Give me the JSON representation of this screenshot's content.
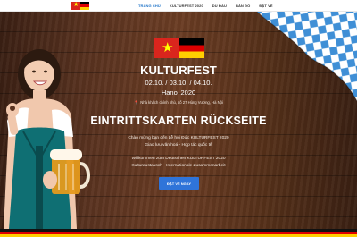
{
  "header": {
    "logo_alt": "Vietnam and Germany flags logo",
    "nav": [
      {
        "label": "TRANG CHỦ",
        "active": true
      },
      {
        "label": "KULTURFEST 2020",
        "active": false
      },
      {
        "label": "DU ĐẤU",
        "active": false
      },
      {
        "label": "BẢN ĐỒ",
        "active": false
      },
      {
        "label": "ĐẶT VÉ",
        "active": false
      }
    ]
  },
  "hero": {
    "event_title": "KULTURFEST",
    "dates": "02.10. / 03.10. / 04.10.",
    "city": "Hanoi 2020",
    "venue": "Nhà khách chính phủ, số 27 Hùng Vương, Hà Nội",
    "ticket_heading": "EINTRITTSKARTEN RÜCKSEITE",
    "welcome_vi_1": "Chào mừng bạn đến Lễ hội Đức KULTURFEST 2020",
    "welcome_vi_2": "Giao lưu văn hoá - Hợp tác quốc tế",
    "welcome_de_1": "Willkommen zum Deutschen KULTURFEST 2020",
    "welcome_de_2": "Kulturaustausch - Internationale Zusammenarbeit",
    "cta_label": "ĐẶT VÉ NGAY"
  },
  "colors": {
    "accent": "#2f74d9",
    "nav_active": "#1e73c8",
    "wood_dark": "#3b2014",
    "flag_de": [
      "#000000",
      "#dd0000",
      "#ffce00"
    ],
    "flag_vn": "#da251d"
  },
  "icons": {
    "venue": "map-marker-icon"
  }
}
